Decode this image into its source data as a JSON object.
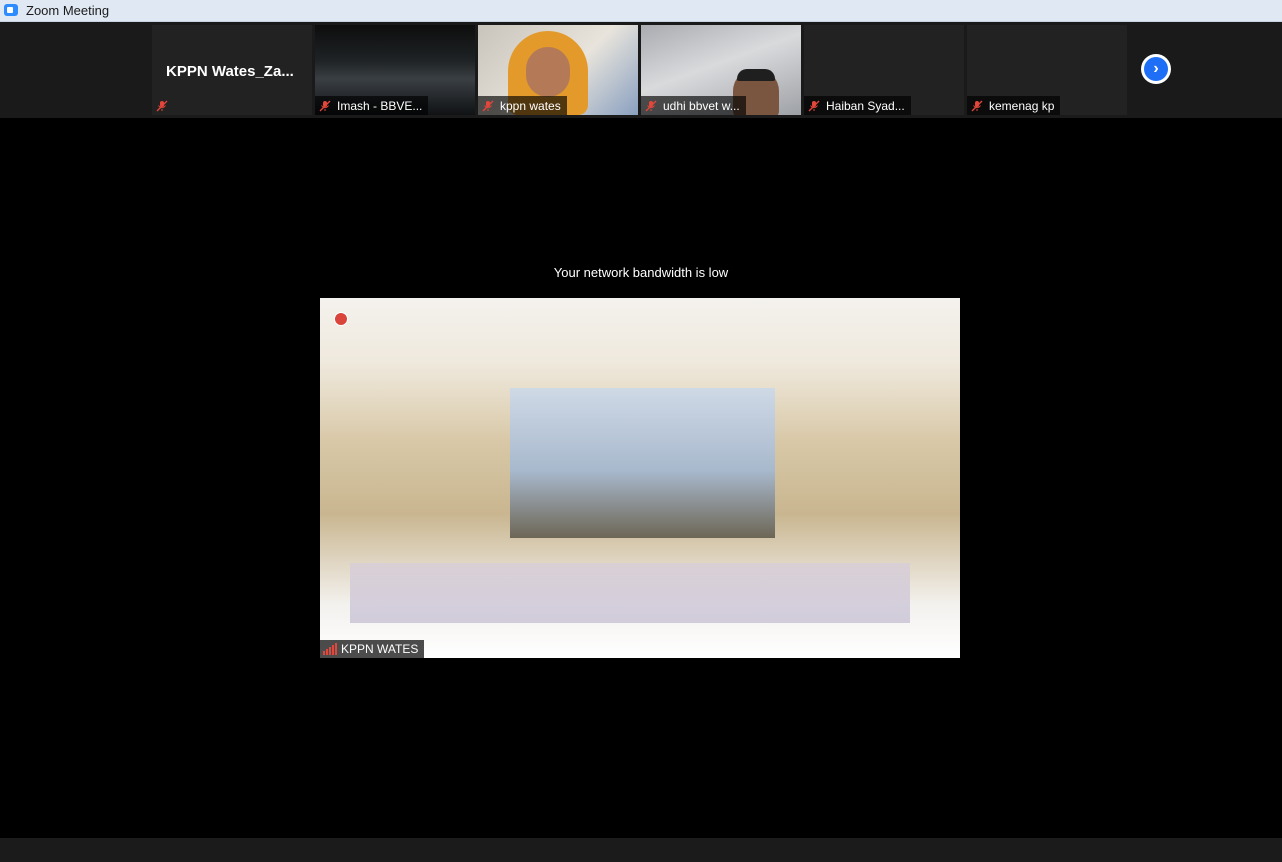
{
  "window": {
    "title": "Zoom Meeting"
  },
  "participants": [
    {
      "name": "KPPN  Wates_Za...",
      "display": "name-only",
      "tag": ""
    },
    {
      "name": "Imash - BBVE...",
      "display": "video"
    },
    {
      "name": "kppn wates",
      "display": "video"
    },
    {
      "name": "udhi bbvet w...",
      "display": "video"
    },
    {
      "name": "Haiban Syad...",
      "display": "no-video"
    },
    {
      "name": "kemenag kp",
      "display": "no-video"
    }
  ],
  "stage": {
    "notice": "Your network bandwidth is low",
    "active_speaker": "KPPN WATES"
  },
  "colors": {
    "accent": "#1e6ff5",
    "mute": "#e3463a"
  },
  "icons": {
    "next": "chevron-right-icon",
    "mute": "microphone-muted-icon"
  }
}
